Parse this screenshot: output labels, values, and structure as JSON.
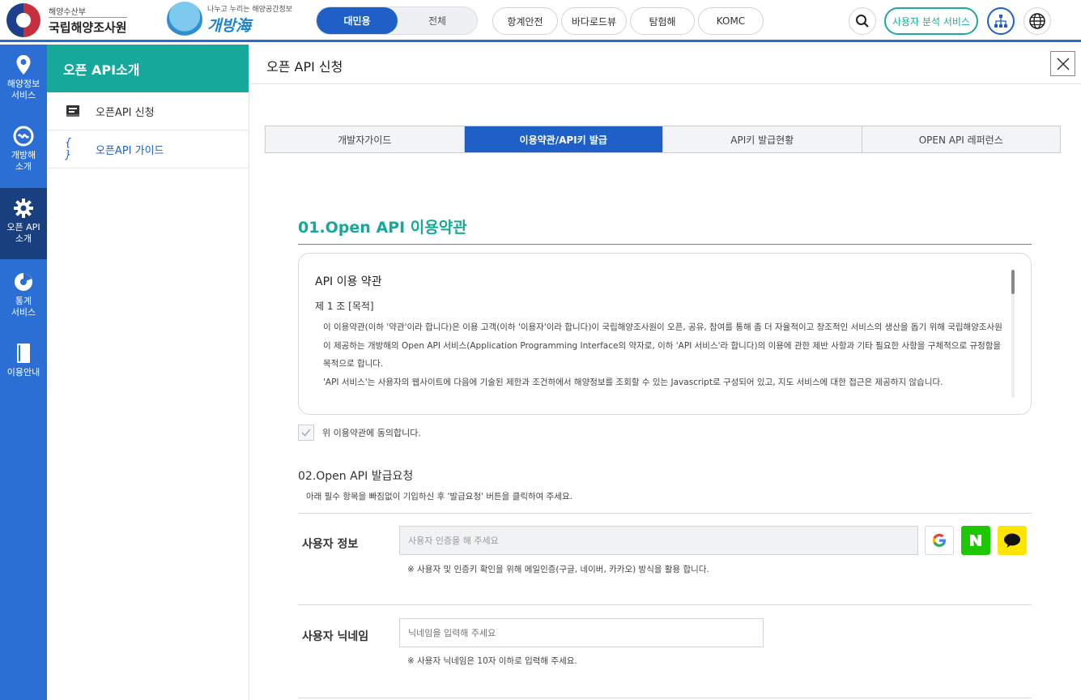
{
  "header": {
    "org_small": "해양수산부",
    "org_name": "국립해양조사원",
    "brand_small": "나누고 누리는 해양공간정보",
    "brand_name": "개방海",
    "mode_toggle": {
      "active": "대민용",
      "inactive": "전체"
    },
    "nav_pills": [
      "항계안전",
      "바다로드뷰",
      "탐험해",
      "KOMC"
    ],
    "analysis_button": "사용자 분석 서비스",
    "icons": [
      "search-icon",
      "sitemap-icon",
      "globe-icon"
    ],
    "colors": {
      "accent": "#1f5fc8",
      "teal": "#16a89a"
    }
  },
  "leftbar": {
    "items": [
      {
        "label1": "해양정보",
        "label2": "서비스",
        "icon": "location-pin-icon"
      },
      {
        "label1": "개방해",
        "label2": "소개",
        "icon": "brand-logo-icon"
      },
      {
        "label1": "오픈 API",
        "label2": "소개",
        "icon": "gear-icon",
        "active": true
      },
      {
        "label1": "통계",
        "label2": "서비스",
        "icon": "pie-chart-icon"
      },
      {
        "label1": "이용안내",
        "label2": "",
        "icon": "book-icon"
      }
    ]
  },
  "submenu": {
    "title": "오픈 API소개",
    "items": [
      {
        "label": "오픈API 신청",
        "icon": "form-icon"
      },
      {
        "label": "오픈API 가이드",
        "icon": "code-braces-icon",
        "active": true
      }
    ]
  },
  "main": {
    "title": "오픈 API 신청",
    "tabs": [
      {
        "label": "개발자가이드"
      },
      {
        "label": "이용약관/API키 발급",
        "active": true
      },
      {
        "label": "API키 발급현황"
      },
      {
        "label": "OPEN API 레퍼런스"
      }
    ],
    "section1_title": "01.Open API 이용약관",
    "terms": {
      "title": "API 이용 약관",
      "article": "제 1 조 [목적]",
      "p1": "이 이용약관(이하 '약관'이라 합니다)은 이용 고객(이하 '이용자'이라 합니다)이 국립해양조사원이 오픈, 공유, 참여를 통해 좀 더 자율적이고 창조적인 서비스의 생산을 돕기 위해 국립해양조사원이 제공하는 개방해의 Open API 서비스(Application Programming Interface의 약자로, 이하 'API 서비스'라 합니다)의 이용에 관한 제반 사항과 기타 필요한 사항을 구체적으로 규정함을 목적으로 합니다.",
      "p2": "'API 서비스'는 사용자의 웹사이트에 다음에 기술된 제한과 조건하에서 해양정보를 조회할 수 있는 Javascript로 구성되어 있고, 지도 서비스에 대한 접근은 제공하지 않습니다."
    },
    "agree_label": "위 이용약관에 동의합니다.",
    "section2_title": "02.Open API 발급요청",
    "section2_desc": "아래 필수 항목을 빠짐없이 기입하신 후 '발급요청' 버튼을 클릭하여 주세요.",
    "user_info": {
      "label": "사용자 정보",
      "placeholder": "사용자 인증을 해 주세요",
      "note": "※ 사용자 및 인증키 확인을 위해 메일인증(구글, 네이버, 카카오) 방식을 활용 합니다.",
      "auth_providers": [
        "Google",
        "Naver",
        "Kakao"
      ]
    },
    "nickname": {
      "label": "사용자 닉네임",
      "placeholder": "닉네임을 입력해 주세요",
      "note": "※ 사용자 닉네임은 10자 이하로 입력해 주세요."
    }
  }
}
